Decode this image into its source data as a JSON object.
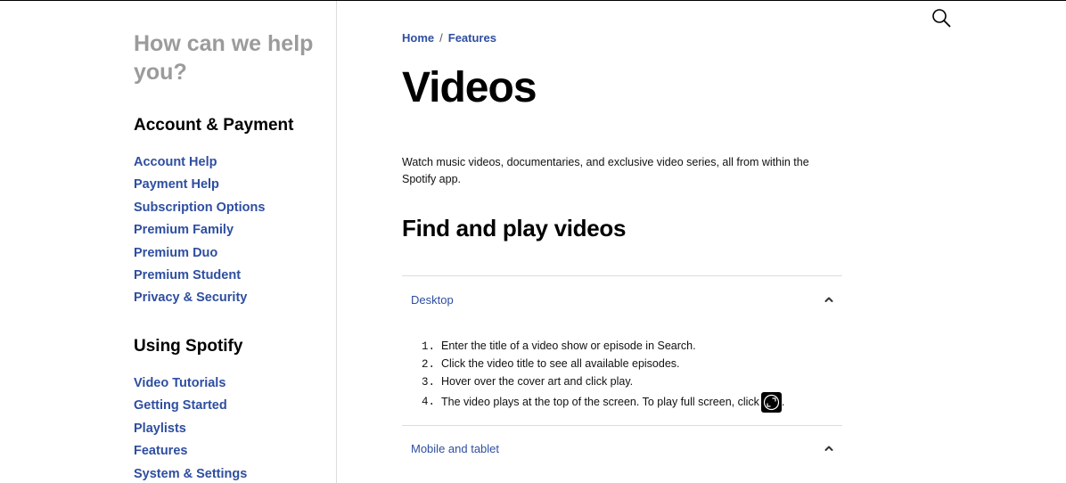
{
  "sidebar": {
    "help_title": "How can we help you?",
    "sections": [
      {
        "title": "Account & Payment",
        "items": [
          "Account Help",
          "Payment Help",
          "Subscription Options",
          "Premium Family",
          "Premium Duo",
          "Premium Student",
          "Privacy & Security"
        ]
      },
      {
        "title": "Using Spotify",
        "items": [
          "Video Tutorials",
          "Getting Started",
          "Playlists",
          "Features",
          "System & Settings"
        ]
      }
    ]
  },
  "breadcrumb": {
    "home": "Home",
    "separator": "/",
    "current": "Features"
  },
  "main": {
    "title": "Videos",
    "intro": "Watch music videos, documentaries, and exclusive video series, all from within the Spotify app.",
    "section_heading": "Find and play videos",
    "accordions": [
      {
        "label": "Desktop",
        "expanded": true,
        "steps": [
          {
            "num": "1.",
            "text": "Enter the title of a video show or episode in Search."
          },
          {
            "num": "2.",
            "text": "Click the video title to see all available episodes."
          },
          {
            "num": "3.",
            "text": "Hover over the cover art and click play."
          },
          {
            "num": "4.",
            "text": "The video plays at the top of the screen. To play full screen, click",
            "trailing": "."
          }
        ]
      },
      {
        "label": "Mobile and tablet",
        "expanded": true
      }
    ]
  },
  "icons": {
    "search": "search-icon",
    "chevron": "chevron-up-icon",
    "fullscreen": "fullscreen-icon"
  },
  "colors": {
    "link": "#2e4ea0",
    "muted_heading": "#9b9b9b",
    "divider": "#dcdcdc"
  }
}
